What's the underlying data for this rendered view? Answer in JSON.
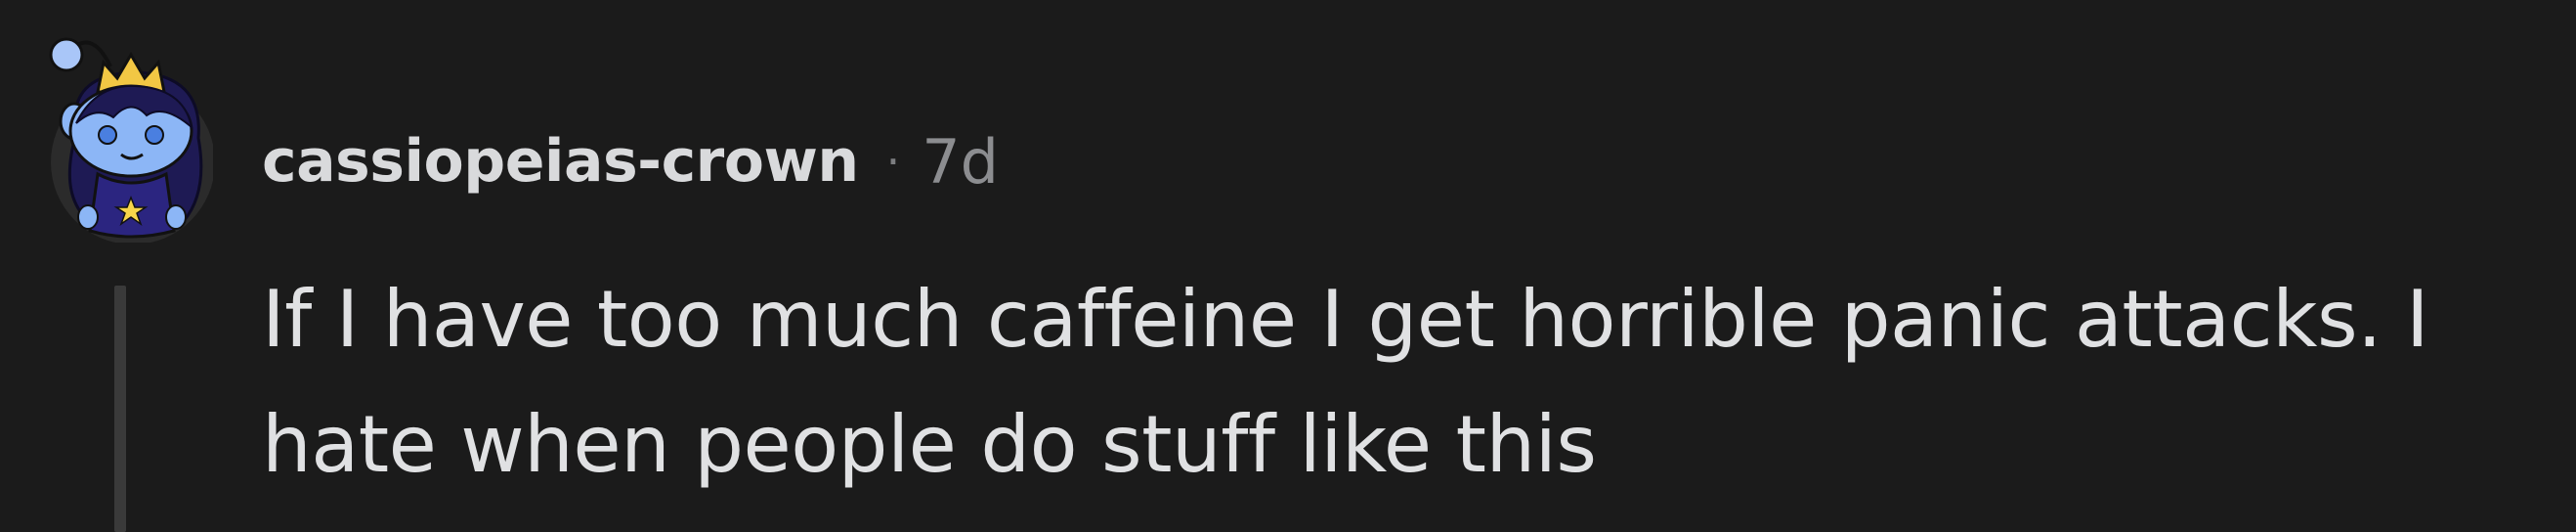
{
  "comment": {
    "author": "cassiopeias-crown",
    "separator": "·",
    "age": "7d",
    "body": "If I have too much caffeine I get horrible panic attacks. I hate when people do stuff like this"
  },
  "avatar": {
    "icon": "snoo-avatar-icon",
    "colors": {
      "skin": "#8cb6f6",
      "hair": "#1e1a54",
      "crown": "#f2c744",
      "shirt": "#2b2580",
      "star": "#f7d54a"
    }
  }
}
